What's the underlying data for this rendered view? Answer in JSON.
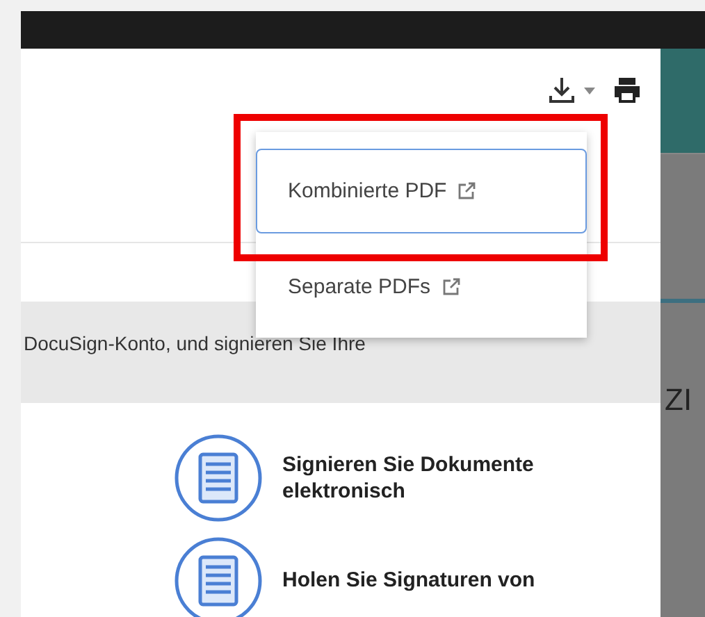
{
  "download_menu": {
    "expanded": true,
    "items": [
      {
        "label": "Kombinierte PDF",
        "selected": true
      },
      {
        "label": "Separate PDFs",
        "selected": false
      }
    ]
  },
  "banner": {
    "text": "DocuSign-Konto, und signieren Sie Ihre"
  },
  "features": [
    {
      "text": "Signieren Sie Dokumente elektronisch"
    },
    {
      "text": "Holen Sie Signaturen von"
    }
  ],
  "side_panel": {
    "text": "ZI"
  }
}
